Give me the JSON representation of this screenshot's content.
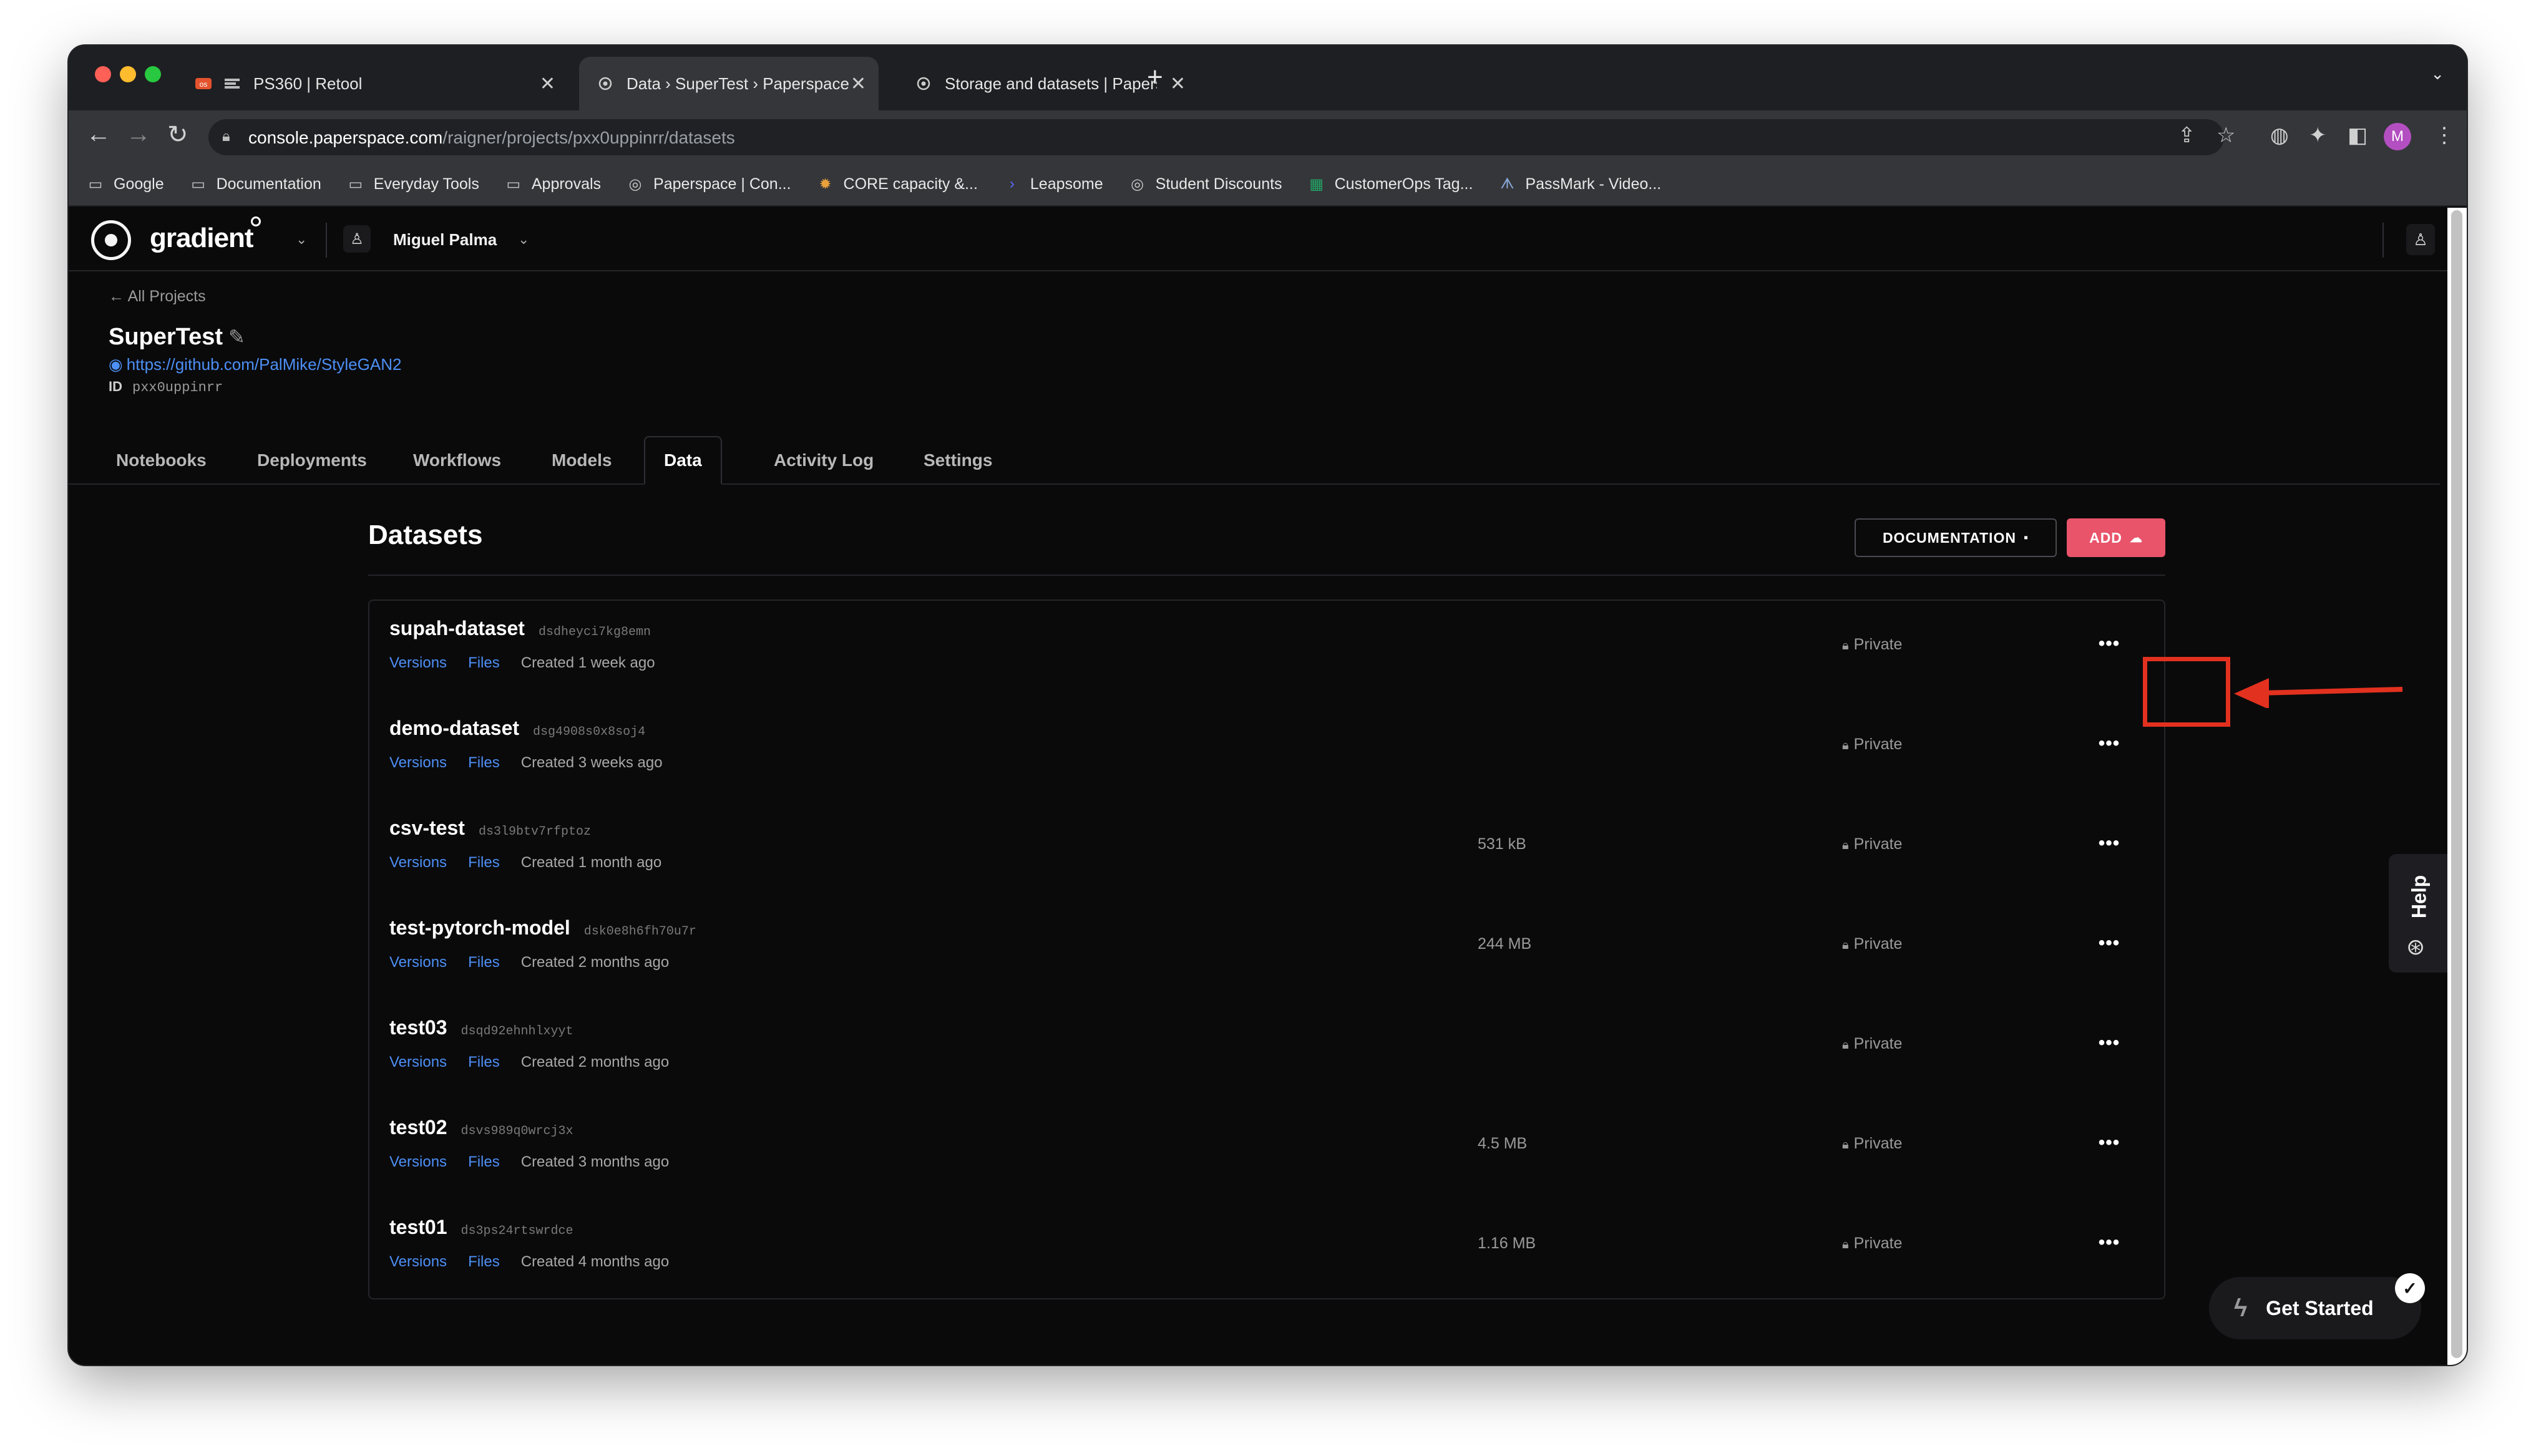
{
  "browser": {
    "tabs": [
      {
        "title": "PS360 | Retool",
        "favicon": "retool-icon"
      },
      {
        "title": "Data › SuperTest › Paperspace",
        "favicon": "paperspace-icon"
      },
      {
        "title": "Storage and datasets | Papersp",
        "favicon": "paperspace-icon"
      }
    ],
    "url_host": "console.paperspace.com",
    "url_path": "/raigner/projects/pxx0uppinrr/datasets",
    "profile_initial": "M",
    "bookmarks": [
      {
        "label": "Google",
        "icon": "folder-icon"
      },
      {
        "label": "Documentation",
        "icon": "folder-icon"
      },
      {
        "label": "Everyday Tools",
        "icon": "folder-icon"
      },
      {
        "label": "Approvals",
        "icon": "folder-icon"
      },
      {
        "label": "Paperspace | Con...",
        "icon": "paperspace-icon"
      },
      {
        "label": "CORE capacity &...",
        "icon": "gear-icon"
      },
      {
        "label": "Leapsome",
        "icon": "leapsome-icon"
      },
      {
        "label": "Student Discounts",
        "icon": "paperspace-icon"
      },
      {
        "label": "CustomerOps Tag...",
        "icon": "sheets-icon"
      },
      {
        "label": "PassMark - Video...",
        "icon": "passmark-icon"
      }
    ]
  },
  "app": {
    "logo": "gradient",
    "user_name": "Miguel Palma"
  },
  "project": {
    "back_label": "All Projects",
    "title": "SuperTest",
    "github_url": "https://github.com/PalMike/StyleGAN2",
    "id_label": "ID",
    "id_value": "pxx0uppinrr",
    "tabs": [
      "Notebooks",
      "Deployments",
      "Workflows",
      "Models",
      "Data",
      "Activity Log",
      "Settings"
    ],
    "active_tab": "Data"
  },
  "datasets": {
    "title": "Datasets",
    "documentation_label": "DOCUMENTATION",
    "add_label": "ADD",
    "versions_label": "Versions",
    "files_label": "Files",
    "items": [
      {
        "name": "supah-dataset",
        "id": "dsdheyci7kg8emn",
        "created": "Created 1 week ago",
        "size": "",
        "visibility": "Private"
      },
      {
        "name": "demo-dataset",
        "id": "dsg4908s0x8soj4",
        "created": "Created 3 weeks ago",
        "size": "",
        "visibility": "Private"
      },
      {
        "name": "csv-test",
        "id": "ds3l9btv7rfptoz",
        "created": "Created 1 month ago",
        "size": "531 kB",
        "visibility": "Private"
      },
      {
        "name": "test-pytorch-model",
        "id": "dsk0e8h6fh70u7r",
        "created": "Created 2 months ago",
        "size": "244 MB",
        "visibility": "Private"
      },
      {
        "name": "test03",
        "id": "dsqd92ehnhlxyyt",
        "created": "Created 2 months ago",
        "size": "",
        "visibility": "Private"
      },
      {
        "name": "test02",
        "id": "dsvs989q0wrcj3x",
        "created": "Created 3 months ago",
        "size": "4.5 MB",
        "visibility": "Private"
      },
      {
        "name": "test01",
        "id": "ds3ps24rtswrdce",
        "created": "Created 4 months ago",
        "size": "1.16 MB",
        "visibility": "Private"
      }
    ]
  },
  "help_label": "Help",
  "get_started_label": "Get Started",
  "colors": {
    "accent_add": "#e9546b",
    "link": "#4d8ff5",
    "annotation": "#e3311f"
  }
}
